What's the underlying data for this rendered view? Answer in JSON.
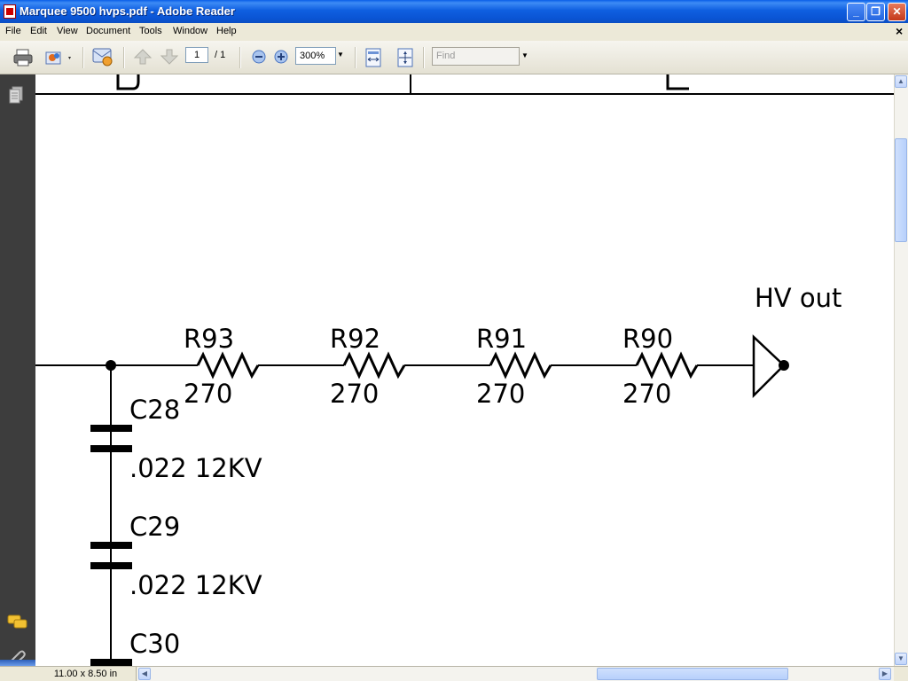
{
  "window": {
    "title": "Marquee 9500 hvps.pdf - Adobe Reader",
    "controls": {
      "minimize": "_",
      "maximize": "❐",
      "close": "✕"
    }
  },
  "menu": {
    "items": [
      "File",
      "Edit",
      "View",
      "Document",
      "Tools",
      "Window",
      "Help"
    ],
    "close_doc": "×"
  },
  "toolbar": {
    "page_current": "1",
    "page_total": "/ 1",
    "zoom": "300%",
    "find_placeholder": "Find",
    "icons": [
      "print-icon",
      "share-icon",
      "email-icon",
      "previous-page-icon",
      "next-page-icon",
      "zoom-out-icon",
      "zoom-in-icon",
      "fit-width-icon",
      "fit-page-icon"
    ]
  },
  "document": {
    "column_markers": [
      "D",
      "E"
    ],
    "resistors": [
      {
        "ref": "R93",
        "value": "270"
      },
      {
        "ref": "R92",
        "value": "270"
      },
      {
        "ref": "R91",
        "value": "270"
      },
      {
        "ref": "R90",
        "value": "270"
      }
    ],
    "capacitors": [
      {
        "ref": "C28",
        "value": ".022 12KV"
      },
      {
        "ref": "C29",
        "value": ".022 12KV"
      },
      {
        "ref": "C30",
        "value": ""
      }
    ],
    "output_label": "HV out"
  },
  "status": {
    "page_size": "11.00 x 8.50 in"
  },
  "colors": {
    "titlebar": "#0a54d4",
    "navpane": "#3d3d3d",
    "chrome": "#ece9d8"
  }
}
